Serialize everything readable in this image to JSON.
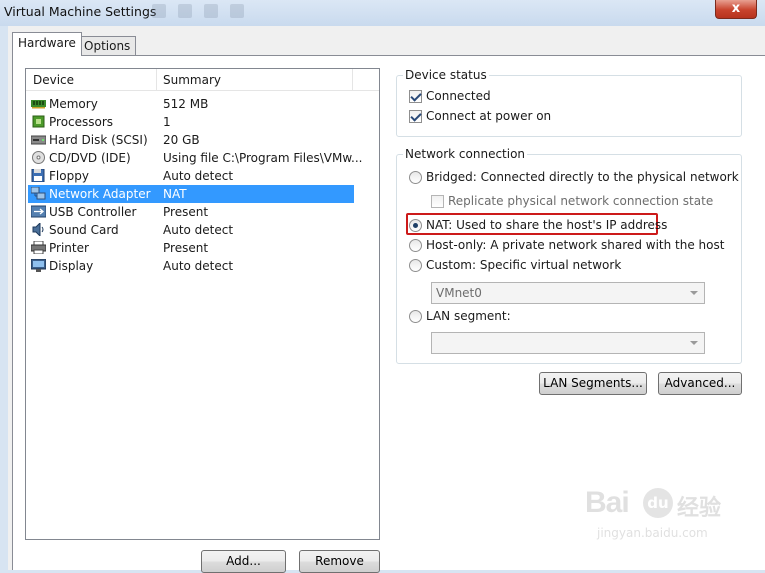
{
  "window": {
    "title": "Virtual Machine Settings",
    "close_glyph": "x"
  },
  "tabs": [
    {
      "label": "Hardware",
      "active": true
    },
    {
      "label": "Options",
      "active": false
    }
  ],
  "device_list": {
    "columns": {
      "device": "Device",
      "summary": "Summary"
    },
    "selected": "Network Adapter",
    "rows": [
      {
        "name": "Memory",
        "summary": "512 MB",
        "icon": "memory-icon"
      },
      {
        "name": "Processors",
        "summary": "1",
        "icon": "processor-icon"
      },
      {
        "name": "Hard Disk (SCSI)",
        "summary": "20 GB",
        "icon": "hard-disk-icon"
      },
      {
        "name": "CD/DVD (IDE)",
        "summary": "Using file C:\\Program Files\\VMw...",
        "icon": "cd-dvd-icon"
      },
      {
        "name": "Floppy",
        "summary": "Auto detect",
        "icon": "floppy-icon"
      },
      {
        "name": "Network Adapter",
        "summary": "NAT",
        "icon": "network-adapter-icon"
      },
      {
        "name": "USB Controller",
        "summary": "Present",
        "icon": "usb-icon"
      },
      {
        "name": "Sound Card",
        "summary": "Auto detect",
        "icon": "sound-card-icon"
      },
      {
        "name": "Printer",
        "summary": "Present",
        "icon": "printer-icon"
      },
      {
        "name": "Display",
        "summary": "Auto detect",
        "icon": "display-icon"
      }
    ]
  },
  "buttons": {
    "add": "Add...",
    "remove": "Remove",
    "lan_segments": "LAN Segments...",
    "advanced": "Advanced..."
  },
  "device_status": {
    "title": "Device status",
    "connected": {
      "label": "Connected",
      "checked": true
    },
    "connect_at_power_on": {
      "label": "Connect at power on",
      "checked": true
    }
  },
  "network_connection": {
    "title": "Network connection",
    "bridged": {
      "label": "Bridged: Connected directly to the physical network",
      "checked": false
    },
    "replicate": {
      "label": "Replicate physical network connection state",
      "checked": false,
      "enabled": false
    },
    "nat": {
      "label": "NAT: Used to share the host's IP address",
      "checked": true
    },
    "host_only": {
      "label": "Host-only: A private network shared with the host",
      "checked": false
    },
    "custom": {
      "label": "Custom: Specific virtual network",
      "checked": false
    },
    "custom_select": {
      "value": "VMnet0"
    },
    "lan_segment": {
      "label": "LAN segment:",
      "checked": false
    },
    "lan_segment_select": {
      "value": ""
    }
  },
  "watermark": {
    "brand": "Bai",
    "paw": "du",
    "chinese": "经验",
    "url": "jingyan.baidu.com"
  },
  "colors": {
    "selection": "#3399ff",
    "highlight_box": "#cc1a1a"
  }
}
